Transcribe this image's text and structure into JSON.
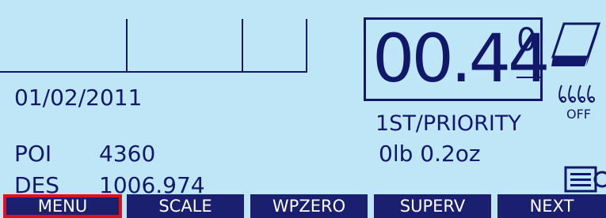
{
  "display": {
    "date": "01/02/2011",
    "weight_main": "00.44",
    "weight_sup": "0",
    "service": "1ST/PRIORITY",
    "weight_oz": "0lb 0.2oz",
    "poi_label": "POI",
    "poi_value": "4360",
    "des_label": "DES",
    "des_value": "1006.974",
    "ink_status": "OFF"
  },
  "softkeys": {
    "menu": "MENU",
    "scale": "SCALE",
    "wpzero": "WPZERO",
    "superv": "SUPERV",
    "next": "NEXT"
  },
  "colors": {
    "background": "#bfe6f7",
    "ink": "#11186a",
    "softkey_bg": "#1a1f6f",
    "selection_outline": "#e0101b"
  },
  "icons": [
    "envelope-icon",
    "ink-drops-icon",
    "menu-lines-icon"
  ]
}
